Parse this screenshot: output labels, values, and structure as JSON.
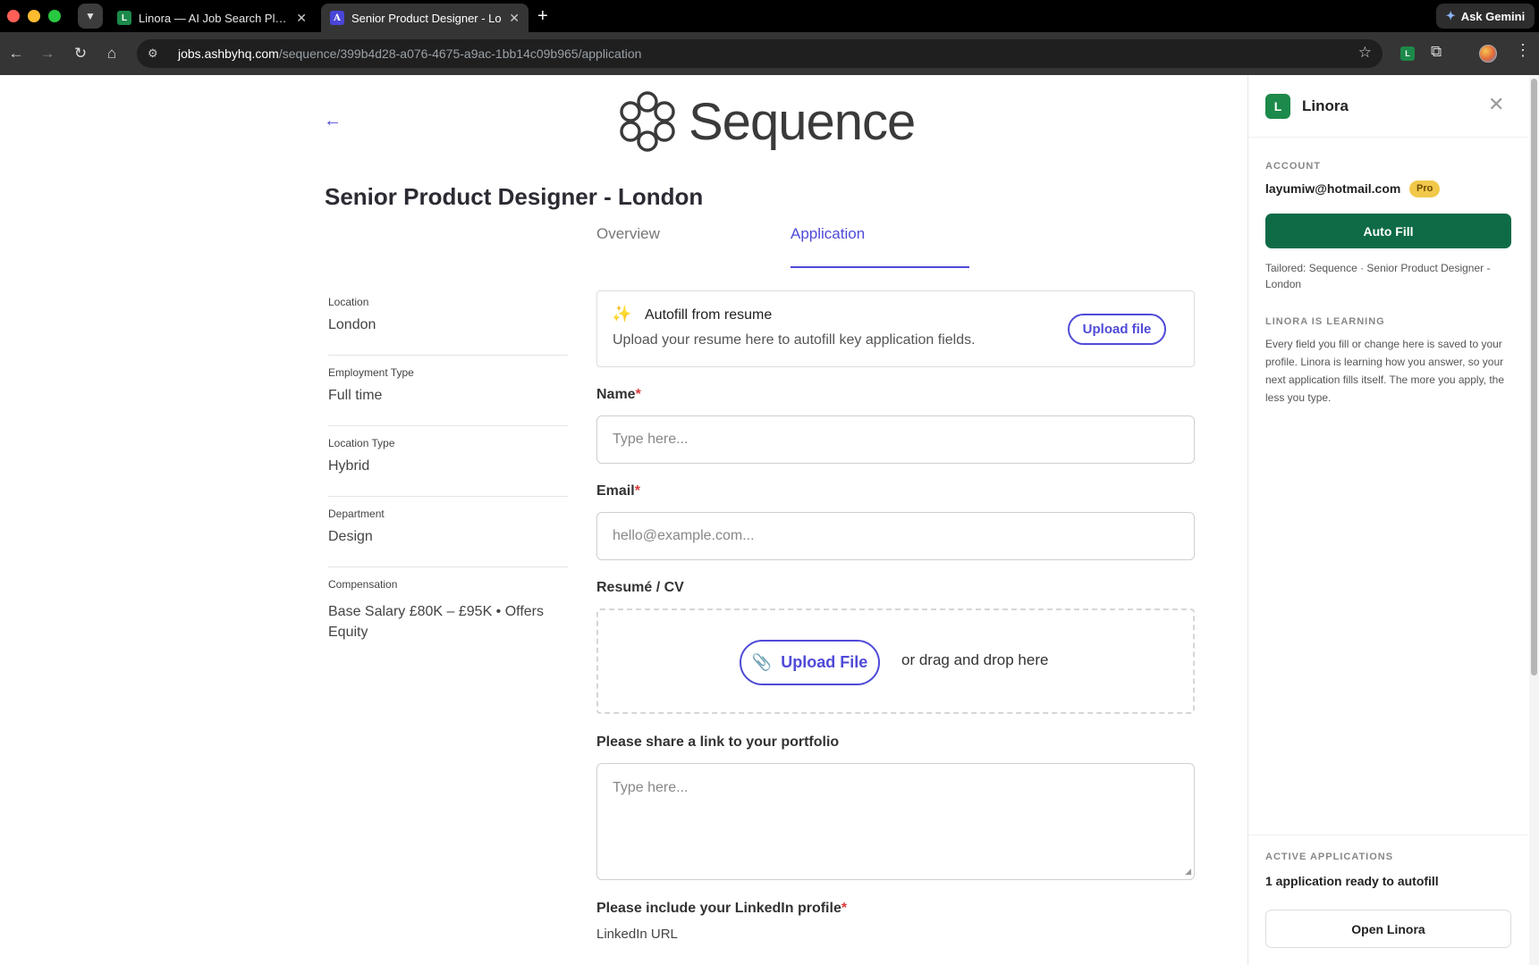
{
  "browser": {
    "tabs": [
      {
        "title": "Linora — AI Job Search Platfo",
        "favicon": "L"
      },
      {
        "title": "Senior Product Designer - Lo",
        "favicon": "A"
      }
    ],
    "ask_gemini": "Ask Gemini",
    "url_host": "jobs.ashbyhq.com",
    "url_path": "/sequence/399b4d28-a076-4675-a9ac-1bb14c09b965/application"
  },
  "page": {
    "logo_text": "Sequence",
    "job_title": "Senior Product Designer - London",
    "tabs": {
      "overview": "Overview",
      "application": "Application"
    },
    "info": [
      {
        "label": "Location",
        "value": "London"
      },
      {
        "label": "Employment Type",
        "value": "Full time"
      },
      {
        "label": "Location Type",
        "value": "Hybrid"
      },
      {
        "label": "Department",
        "value": "Design"
      },
      {
        "label": "Compensation",
        "value": "Base Salary £80K – £95K • Offers Equity"
      }
    ],
    "autofill": {
      "title": "Autofill from resume",
      "subtitle": "Upload your resume here to autofill key application fields.",
      "button": "Upload file"
    },
    "form": {
      "name_label": "Name",
      "name_placeholder": "Type here...",
      "email_label": "Email",
      "email_placeholder": "hello@example.com...",
      "resume_label": "Resumé / CV",
      "upload_button": "Upload File",
      "drag_text": "or drag and drop here",
      "portfolio_label": "Please share a link to your  portfolio",
      "portfolio_placeholder": "Type here...",
      "linkedin_label": "Please include your LinkedIn profile",
      "linkedin_sub": "LinkedIn URL",
      "required_mark": "*"
    }
  },
  "panel": {
    "name": "Linora",
    "logo": "L",
    "account_label": "ACCOUNT",
    "email": "layumiw@hotmail.com",
    "badge": "Pro",
    "autofill_button": "Auto Fill",
    "tailored": "Tailored: Sequence · Senior Product Designer - London",
    "learning_label": "LINORA IS LEARNING",
    "learning_text": "Every field you fill or change here is saved to your profile. Linora is learning how you answer, so your next application fills itself. The more you apply, the less you type.",
    "active_label": "ACTIVE APPLICATIONS",
    "active_text": "1 application ready to autofill",
    "open_button": "Open Linora"
  },
  "colors": {
    "accent": "#4f4ad8",
    "linora_green": "#0f6b45",
    "required": "#d93a3a",
    "pro_badge": "#f2c84b"
  }
}
